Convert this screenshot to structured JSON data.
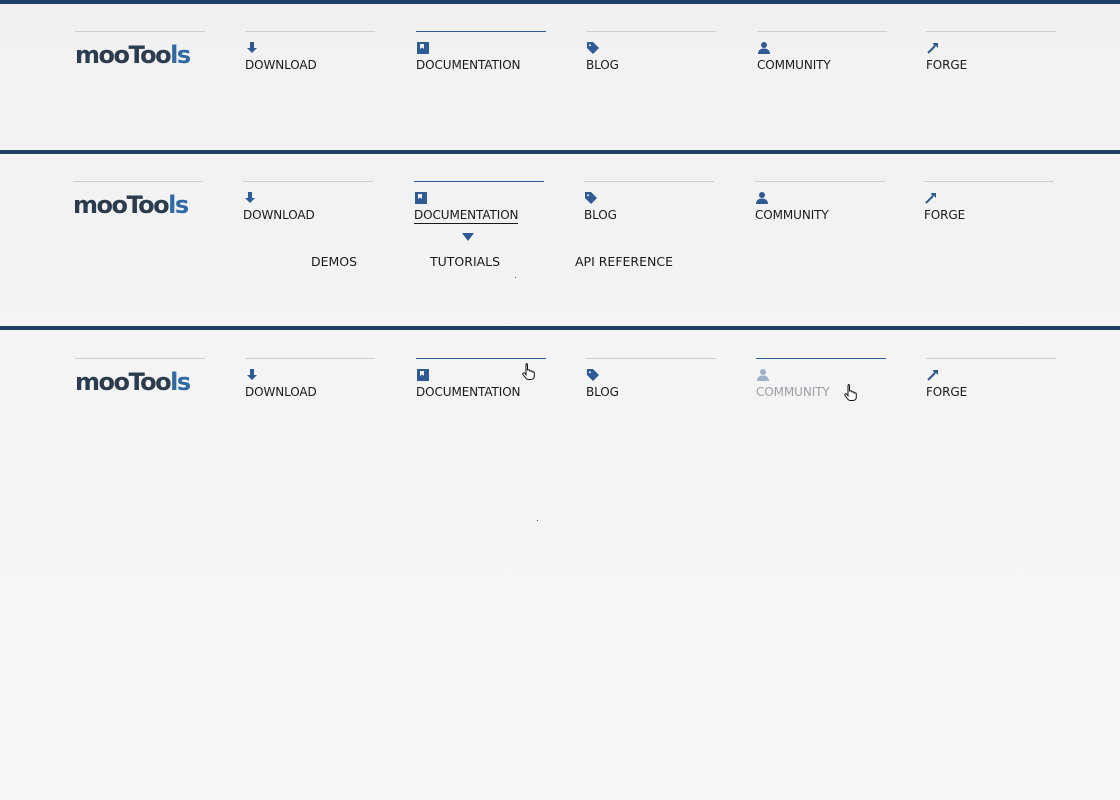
{
  "colors": {
    "brand_dark": "#2b3c4e",
    "brand_blue": "#2e6aa8",
    "accent": "#1f3f68",
    "icon": "#2e5a95"
  },
  "logo": {
    "part1": "mooToo",
    "part2": "ls",
    "text": "mootools"
  },
  "nav": [
    {
      "label": "DOWNLOAD",
      "icon": "download-icon"
    },
    {
      "label": "DOCUMENTATION",
      "icon": "book-icon"
    },
    {
      "label": "BLOG",
      "icon": "tag-icon"
    },
    {
      "label": "COMMUNITY",
      "icon": "user-icon"
    },
    {
      "label": "FORGE",
      "icon": "hammer-icon"
    }
  ],
  "states": [
    {
      "active": "DOCUMENTATION"
    },
    {
      "active": "DOCUMENTATION",
      "hover": "DOCUMENTATION",
      "submenu": [
        "DEMOS",
        "TUTORIALS",
        "API REFERENCE"
      ]
    },
    {
      "active": "COMMUNITY",
      "hover": "COMMUNITY"
    }
  ]
}
